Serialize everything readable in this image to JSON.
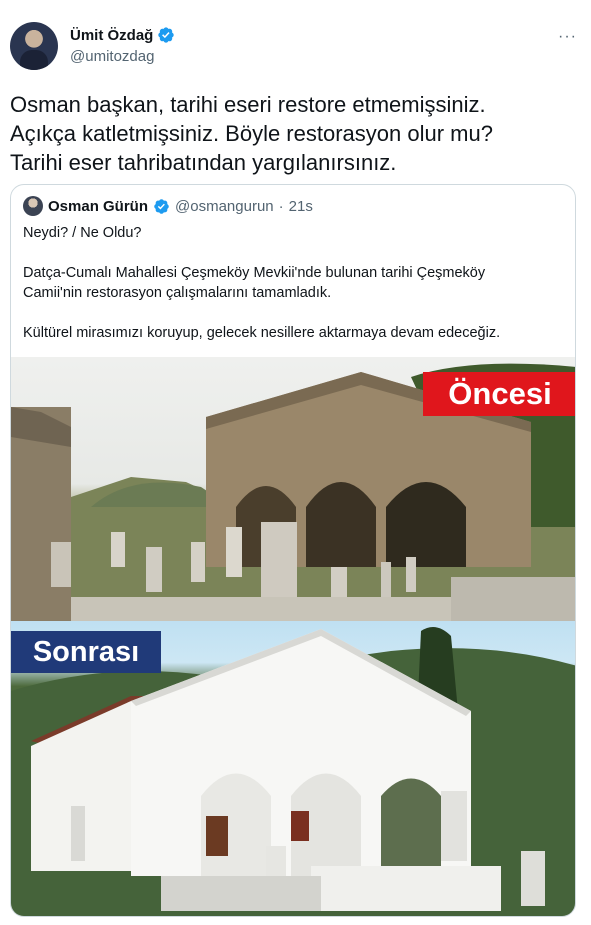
{
  "author": {
    "display_name": "Ümit Özdağ",
    "handle": "@umitozdag"
  },
  "more_menu": "···",
  "tweet": {
    "lines": [
      "Osman başkan, tarihi eseri restore etmemişsiniz.",
      "Açıkça katletmişsiniz. Böyle restorasyon olur mu?",
      "Tarihi eser tahribatından yargılanırsınız."
    ]
  },
  "quoted": {
    "display_name": "Osman Gürün",
    "handle": "@osmangurun",
    "separator": "·",
    "time": "21s",
    "text": {
      "line1": "Neydi? / Ne Oldu?",
      "line2a": "Datça-Cumalı Mahallesi Çeşmeköy Mevkii'nde bulunan tarihi Çeşmeköy",
      "line2b": "Camii'nin restorasyon çalışmalarını tamamladık.",
      "line3": "Kültürel mirasımızı koruyup, gelecek nesillere aktarmaya devam edeceğiz."
    },
    "image": {
      "before_label": "Öncesi",
      "after_label": "Sonrası"
    }
  },
  "colors": {
    "verified": "#1d9bf0",
    "before_label_bg": "#e0161c",
    "after_label_bg": "#203a79"
  }
}
